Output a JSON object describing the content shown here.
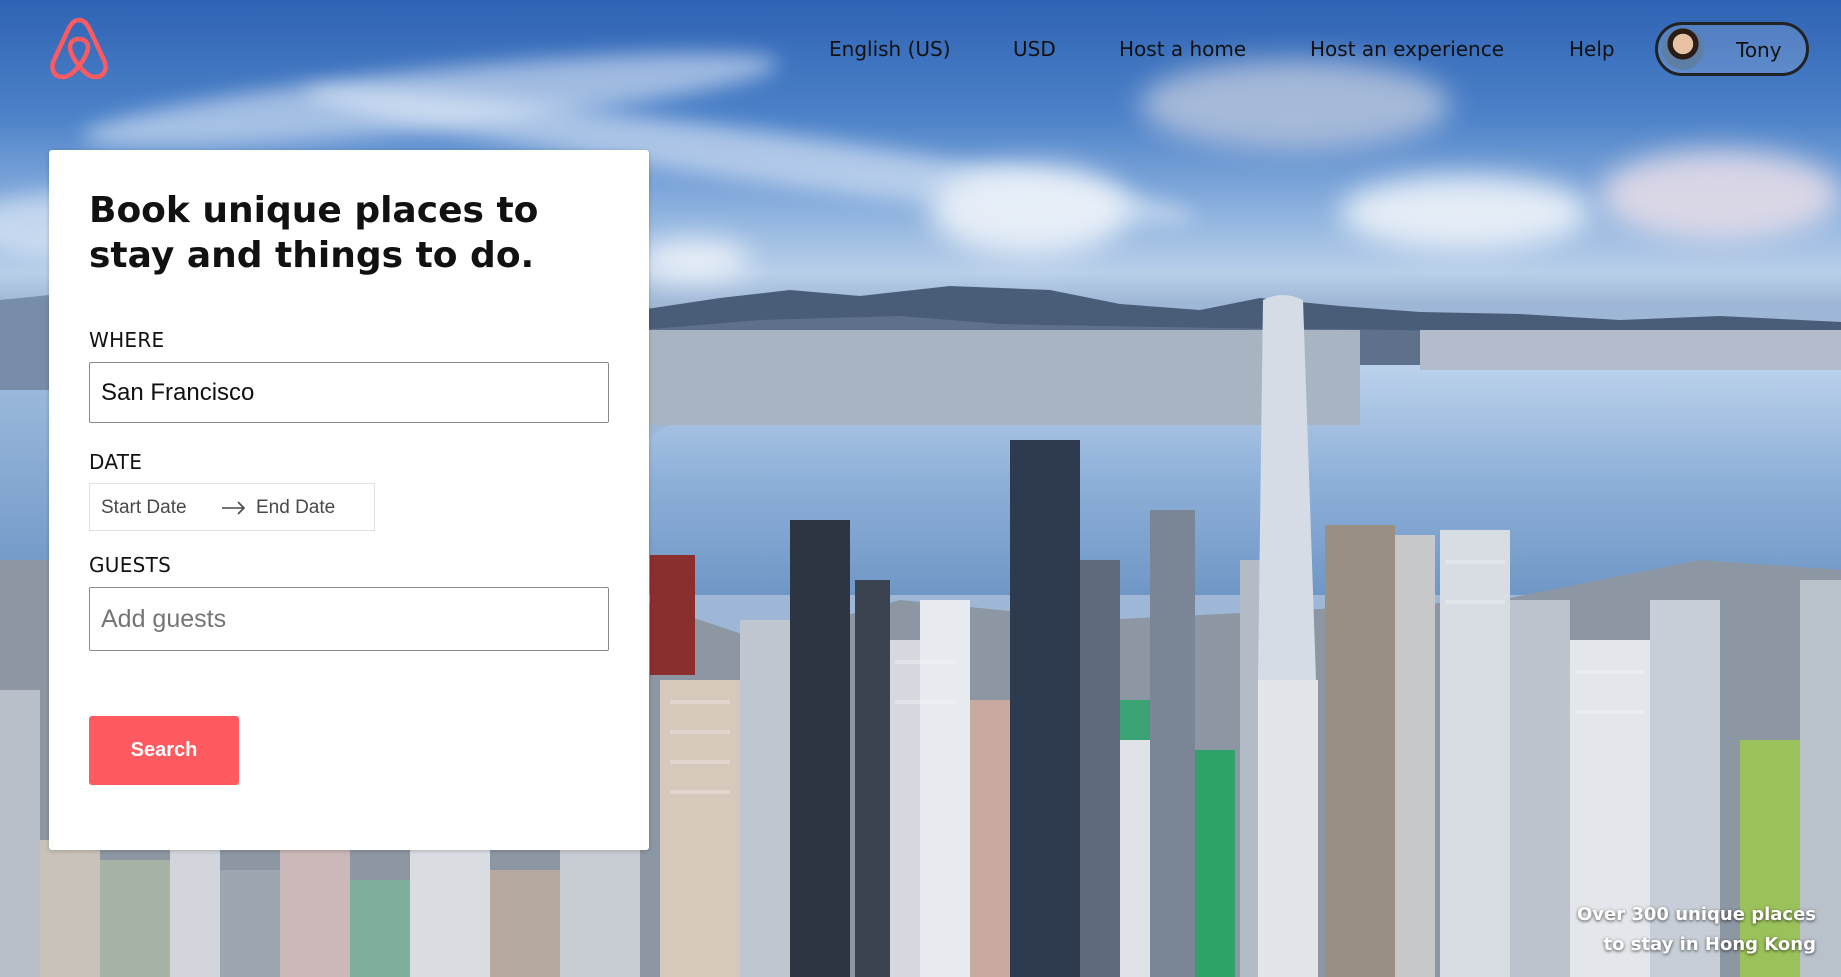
{
  "nav": {
    "logo_icon": "airbnb-belo-logo",
    "links": [
      "English (US)",
      "USD",
      "Host a home",
      "Host an experience",
      "Help"
    ],
    "profile": {
      "name": "Tony",
      "avatar_icon": "user-avatar"
    }
  },
  "search_card": {
    "title": "Book unique places to stay and things to do.",
    "where": {
      "label": "WHERE",
      "value": "San Francisco",
      "placeholder": ""
    },
    "date": {
      "label": "DATE",
      "start_placeholder": "Start Date",
      "arrow_icon": "arrow-right-icon",
      "end_placeholder": "End Date"
    },
    "guests": {
      "label": "GUESTS",
      "placeholder": "Add guests"
    },
    "search_label": "Search"
  },
  "hero": {
    "caption_line1": "Over 300 unique places",
    "caption_line2": "to stay in Hong Kong"
  },
  "colors": {
    "brand": "#ff5a5f",
    "text": "#111111"
  }
}
